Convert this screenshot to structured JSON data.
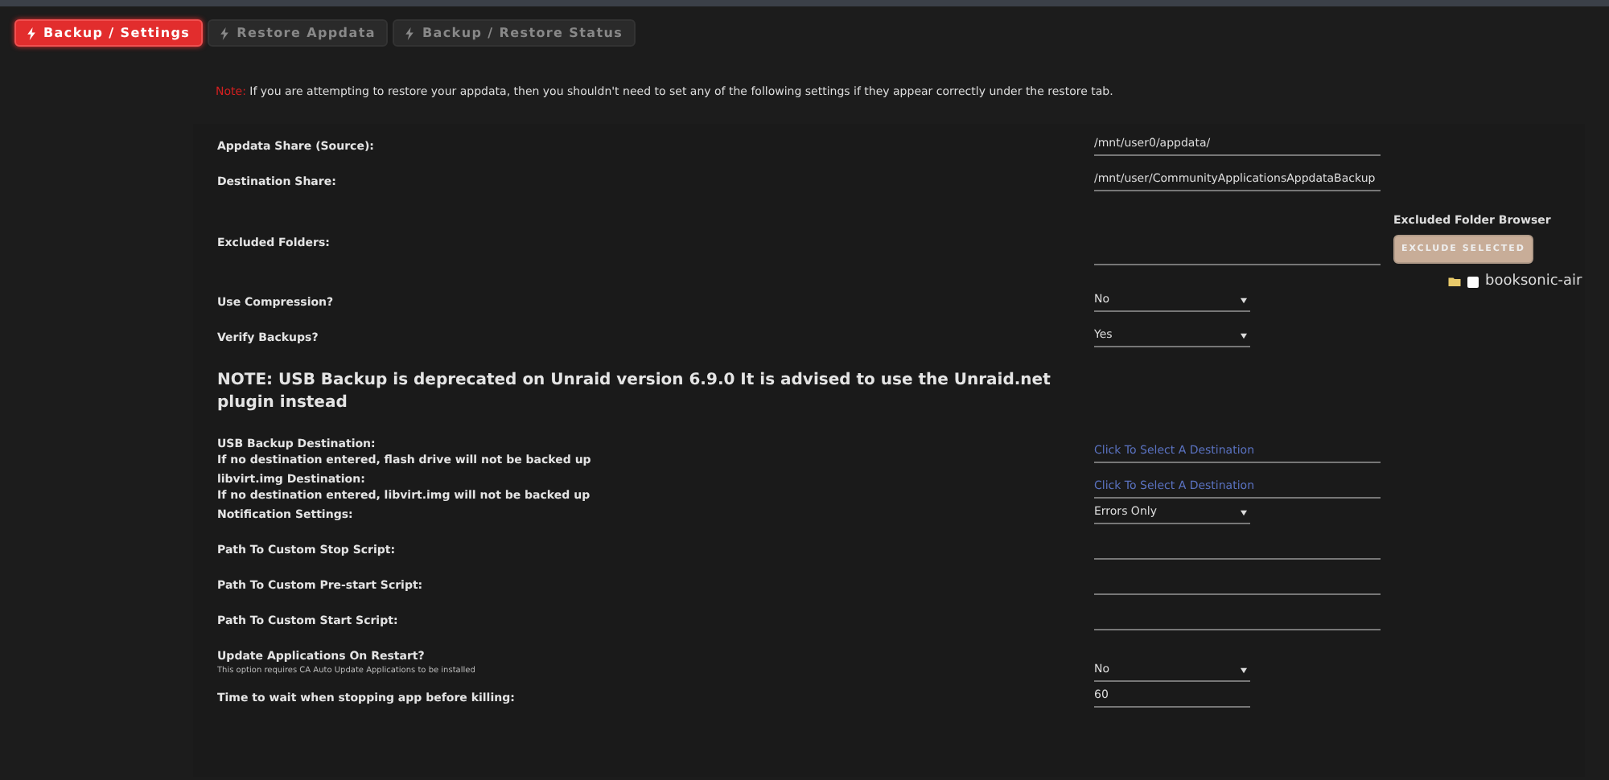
{
  "tabs": [
    {
      "label": "Backup / Settings",
      "selected": true
    },
    {
      "label": "Restore Appdata",
      "selected": false
    },
    {
      "label": "Backup / Restore Status",
      "selected": false
    }
  ],
  "note": {
    "label": "Note:",
    "text": "If you are attempting to restore your appdata, then you shouldn't need to set any of the following settings if they appear correctly under the restore tab."
  },
  "settings": [
    {
      "label": "Appdata Share (Source):",
      "kind": "text",
      "value": "/mnt/user0/appdata/"
    },
    {
      "label": "Destination Share:",
      "kind": "text",
      "value": "/mnt/user/CommunityApplicationsAppdataBackup"
    },
    {
      "label": "Excluded Folders:",
      "kind": "excluded"
    },
    {
      "label": "Use Compression?",
      "kind": "select",
      "value": "No"
    },
    {
      "label": "Verify Backups?",
      "kind": "select",
      "value": "Yes"
    }
  ],
  "excluded_browser": {
    "title": "Excluded Folder Browser",
    "button": "EXCLUDE SELECTED",
    "folders": [
      {
        "name": "booksonic-air",
        "checked": false
      }
    ]
  },
  "notice": "NOTE: USB Backup is deprecated on Unraid version 6.9.0 It is advised to use the Unraid.net plugin instead",
  "settings2": [
    {
      "label": "USB Backup Destination:",
      "hint": "If no destination entered, flash drive will not be backed up",
      "kind": "picker",
      "value": "Click To Select A Destination"
    },
    {
      "label": "libvirt.img Destination:",
      "hint": "If no destination entered, libvirt.img will not be backed up",
      "kind": "picker",
      "value": "Click To Select A Destination"
    },
    {
      "label": "Notification Settings:",
      "kind": "select",
      "value": "Errors Only"
    },
    {
      "label": "Path To Custom Stop Script:",
      "kind": "blank"
    },
    {
      "label": "Path To Custom Pre-start Script:",
      "kind": "blank"
    },
    {
      "label": "Path To Custom Start Script:",
      "kind": "blank"
    },
    {
      "label": "Update Applications On Restart?",
      "small_note": "This option requires CA Auto Update Applications to be installed",
      "kind": "select",
      "value": "No"
    },
    {
      "label": "Time to wait when stopping app before killing:",
      "kind": "number",
      "value": "60"
    }
  ]
}
